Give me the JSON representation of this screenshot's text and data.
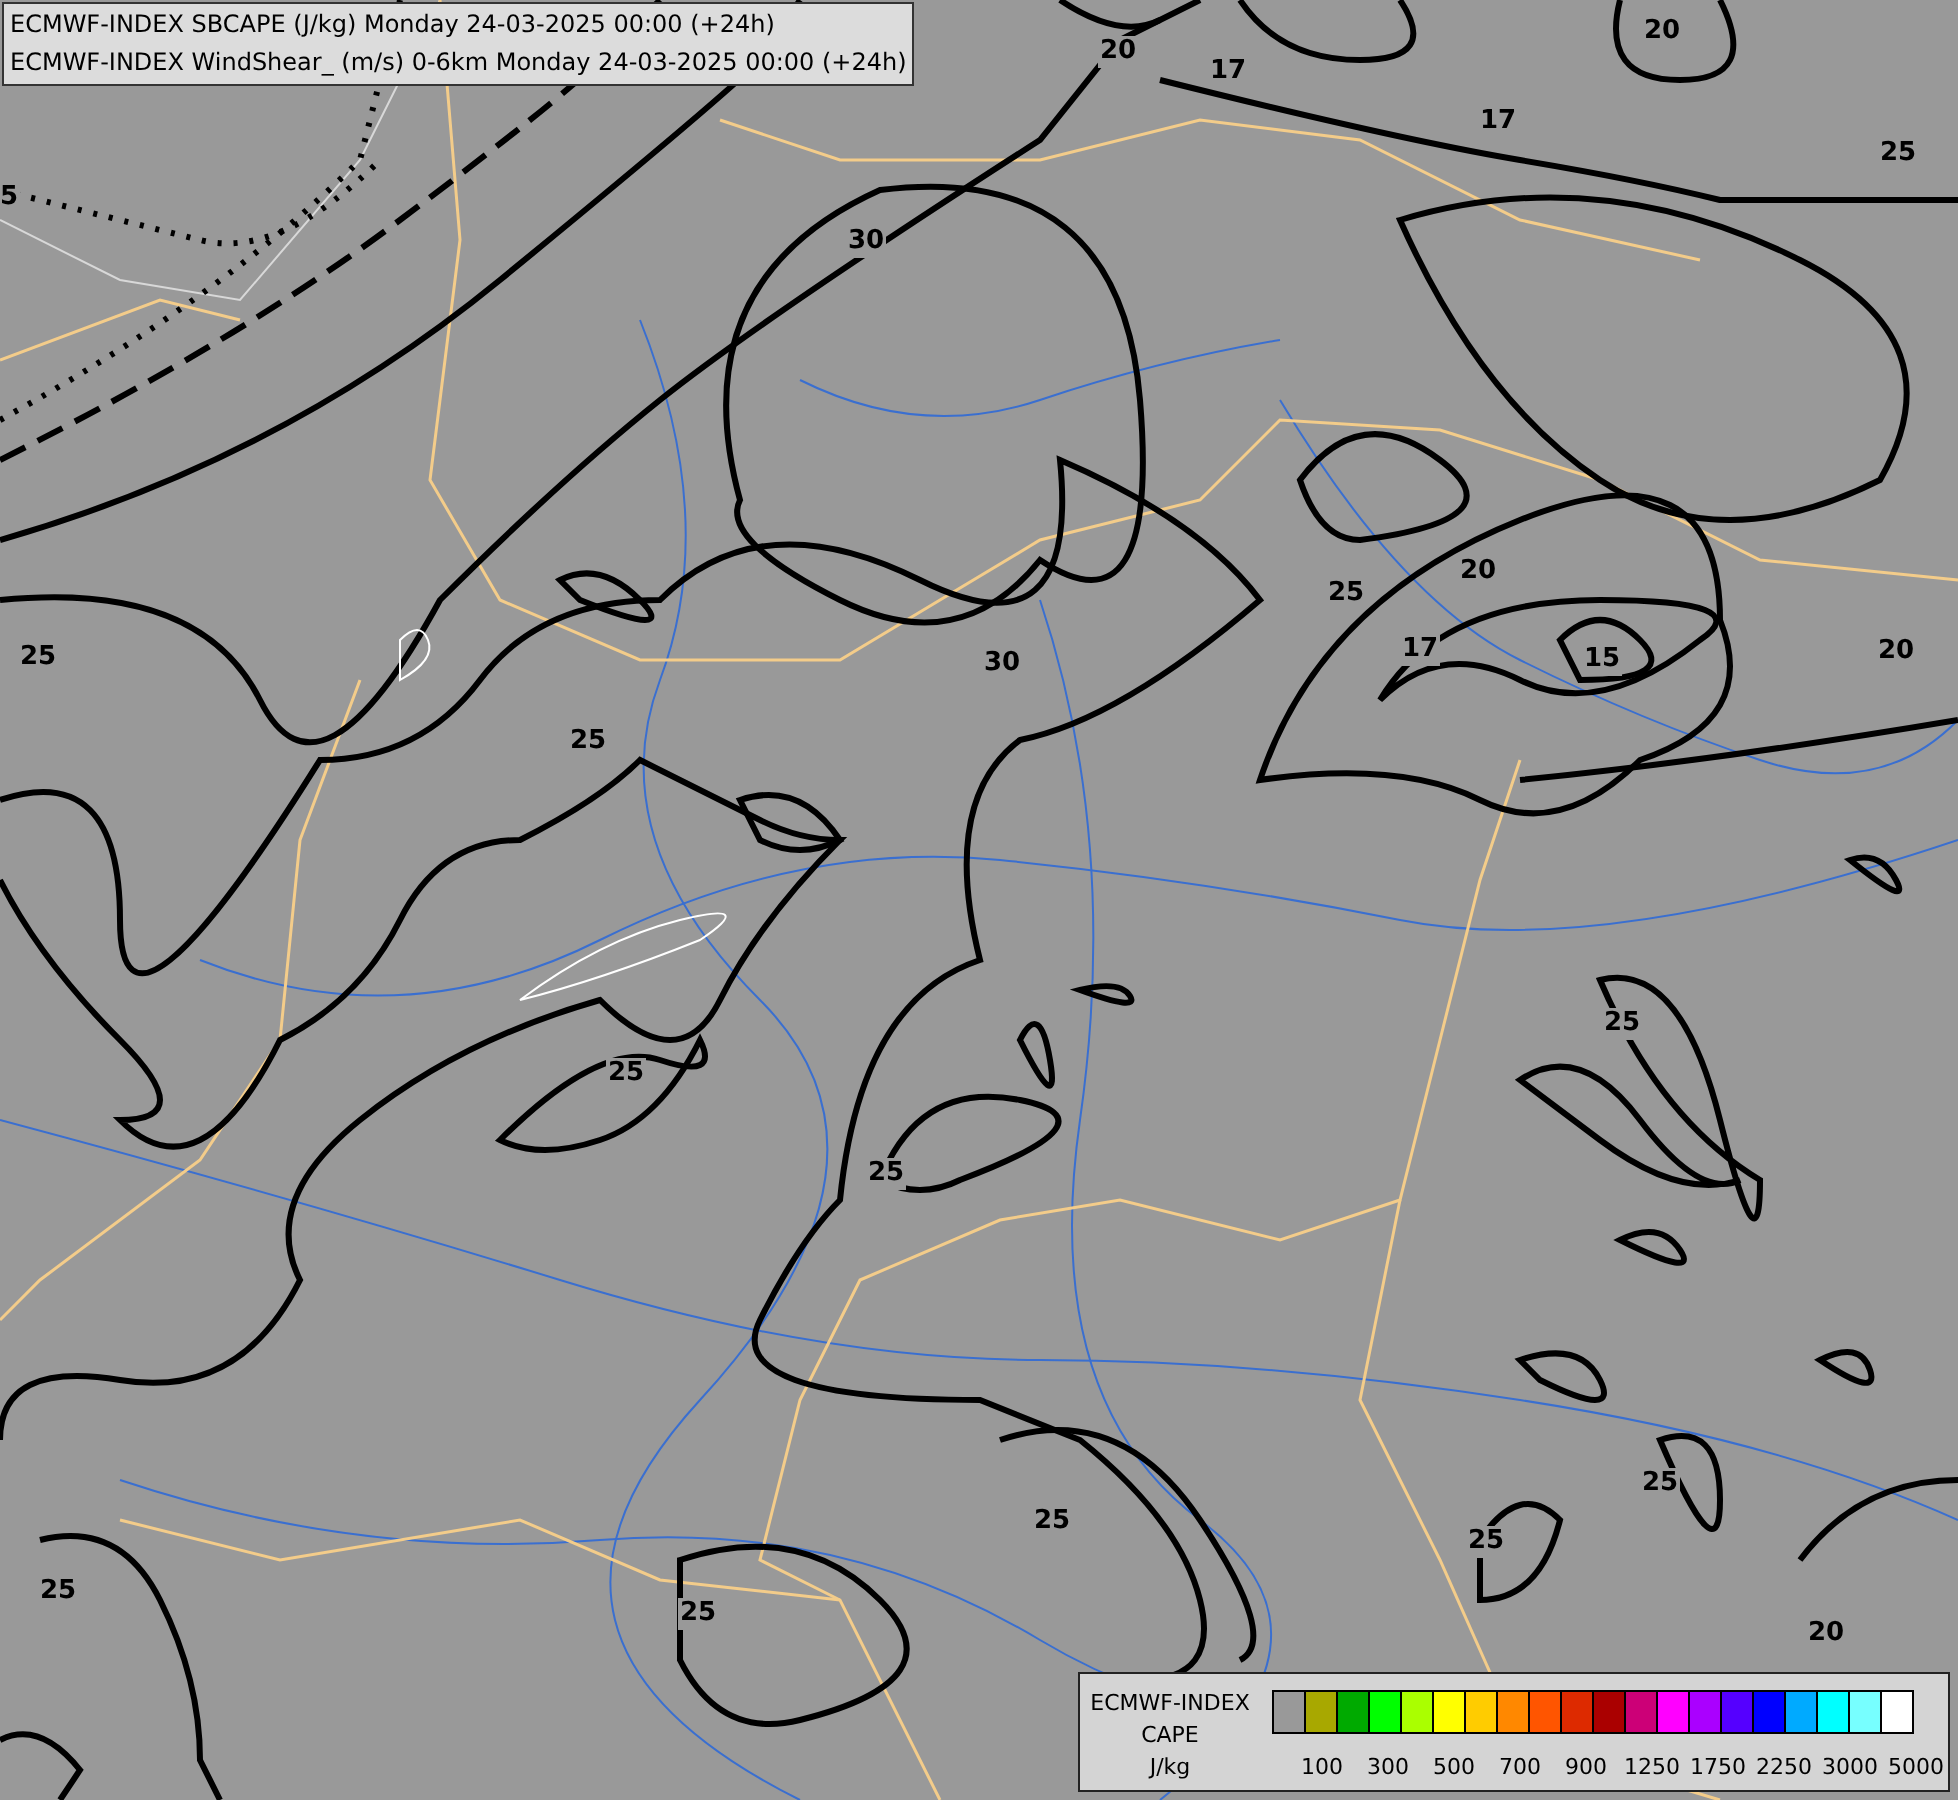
{
  "header": {
    "lines": [
      "ECMWF-INDEX SBCAPE (J/kg) Monday 24-03-2025 00:00 (+24h)",
      "ECMWF-INDEX WindShear_ (m/s) 0-6km Monday 24-03-2025 00:00 (+24h)"
    ]
  },
  "contour_labels": [
    "20",
    "17",
    "20",
    "17",
    "25",
    "5",
    "30",
    "25",
    "20",
    "25",
    "30",
    "17",
    "15",
    "20",
    "25",
    "25",
    "25",
    "25",
    "25",
    "25",
    "25",
    "25",
    "25",
    "20"
  ],
  "legend": {
    "title_lines": [
      "ECMWF-INDEX",
      "CAPE",
      "J/kg"
    ],
    "swatches": [
      {
        "color": "#999999"
      },
      {
        "color": "#a8a800"
      },
      {
        "color": "#00aa00"
      },
      {
        "color": "#00ff00"
      },
      {
        "color": "#aaff00"
      },
      {
        "color": "#ffff00"
      },
      {
        "color": "#ffcc00"
      },
      {
        "color": "#ff8800"
      },
      {
        "color": "#ff5500"
      },
      {
        "color": "#dd2a00"
      },
      {
        "color": "#aa0000"
      },
      {
        "color": "#cc0077"
      },
      {
        "color": "#ff00ff"
      },
      {
        "color": "#aa00ff"
      },
      {
        "color": "#5500ff"
      },
      {
        "color": "#0000ff"
      },
      {
        "color": "#00aaff"
      },
      {
        "color": "#00ffff"
      },
      {
        "color": "#77ffff"
      },
      {
        "color": "#ffffff"
      }
    ],
    "labels": [
      "100",
      "300",
      "500",
      "700",
      "900",
      "1250",
      "1750",
      "2250",
      "3000",
      "5000"
    ]
  }
}
